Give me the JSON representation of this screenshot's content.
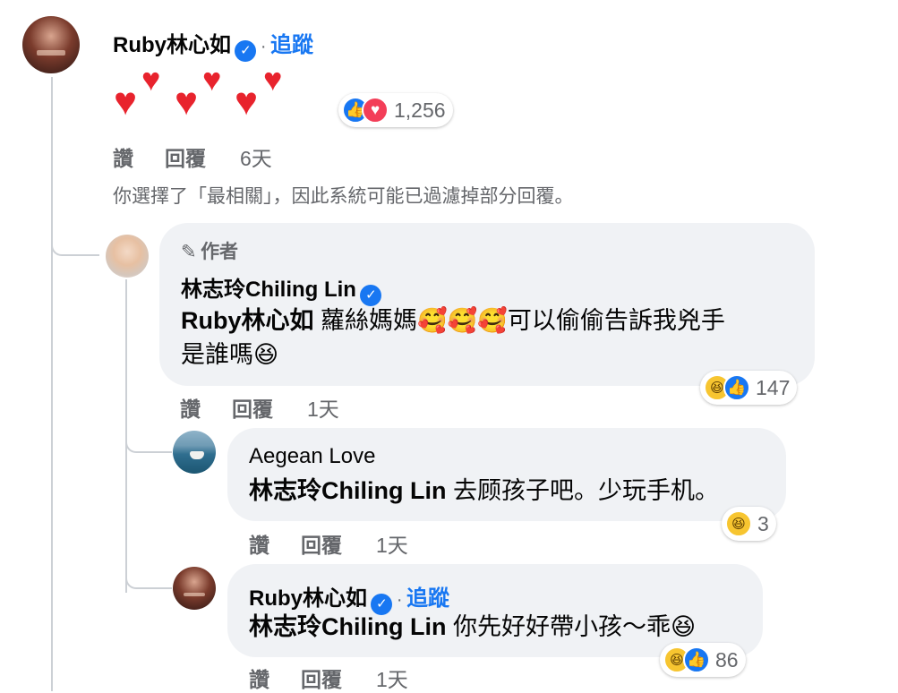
{
  "main_comment": {
    "author": "Ruby林心如",
    "follow": "追蹤",
    "hearts": "❤️❤️❤️",
    "reaction_count": "1,256",
    "like": "讚",
    "reply": "回覆",
    "time": "6天",
    "filter_note": "你選擇了「最相關」，因此系統可能已過濾掉部分回覆。"
  },
  "reply1": {
    "author_tag": "作者",
    "author": "林志玲Chiling Lin",
    "mention": "Ruby林心如",
    "text_line1": "蘿絲媽媽🥰🥰🥰可以偷偷告訴我兇手",
    "text_line2": "是誰嗎😆",
    "reaction_count": "147",
    "like": "讚",
    "reply": "回覆",
    "time": "1天"
  },
  "reply2": {
    "author": "Aegean Love",
    "mention": "林志玲Chiling Lin",
    "text": "去顾孩子吧。少玩手机。",
    "reaction_count": "3",
    "like": "讚",
    "reply": "回覆",
    "time": "1天"
  },
  "reply3": {
    "author": "Ruby林心如",
    "follow": "追蹤",
    "mention": "林志玲Chiling Lin",
    "text": "你先好好帶小孩～乖😆",
    "reaction_count": "86",
    "like": "讚",
    "reply": "回覆",
    "time": "1天"
  }
}
